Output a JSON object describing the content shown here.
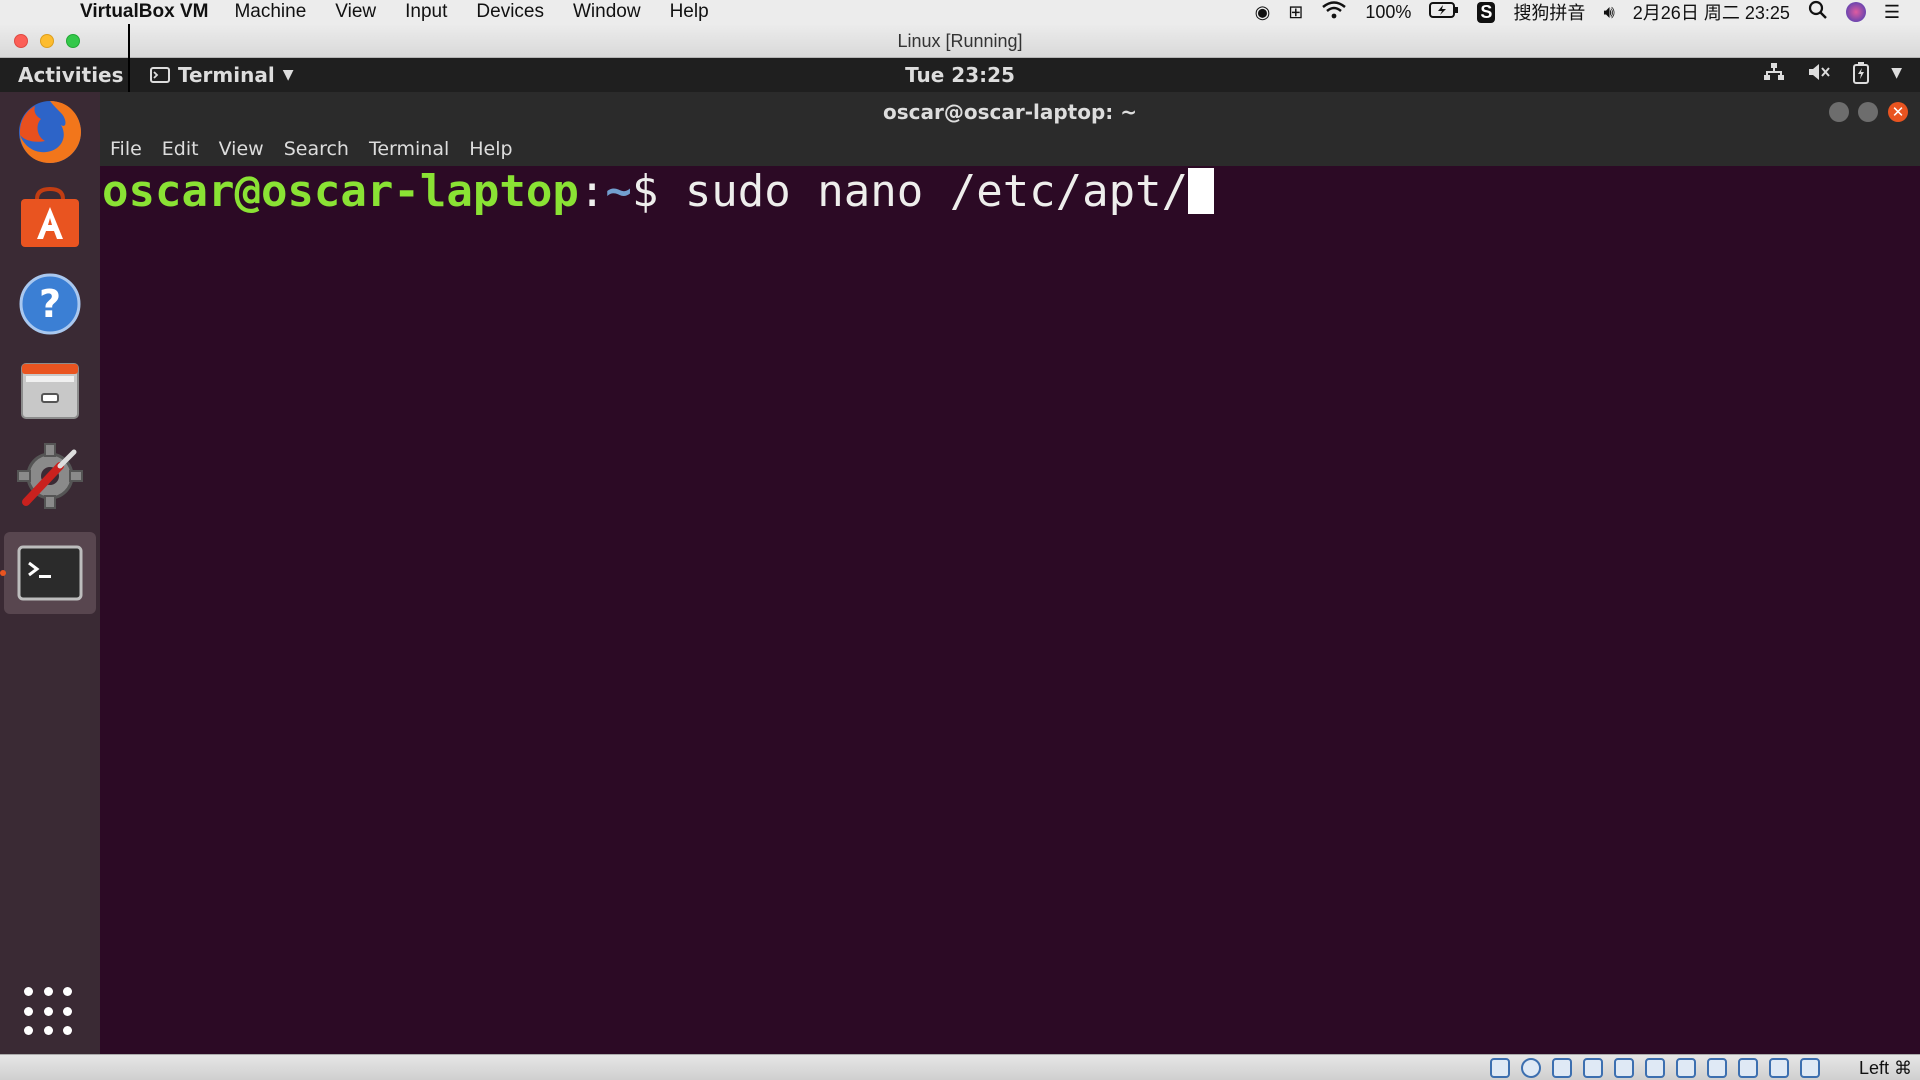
{
  "mac_menubar": {
    "app_name": "VirtualBox VM",
    "menus": [
      "Machine",
      "View",
      "Input",
      "Devices",
      "Window",
      "Help"
    ],
    "battery": "100%",
    "input_method": "搜狗拼音",
    "datetime": "2月26日 周二 23:25"
  },
  "vbox_window": {
    "title": "Linux [Running]",
    "status_host_key": "Left ⌘"
  },
  "ubuntu_panel": {
    "activities": "Activities",
    "app_menu": "Terminal",
    "clock": "Tue 23:25"
  },
  "terminal": {
    "title": "oscar@oscar-laptop: ~",
    "menus": [
      "File",
      "Edit",
      "View",
      "Search",
      "Terminal",
      "Help"
    ],
    "prompt_user": "oscar@oscar-laptop",
    "prompt_sep": ":",
    "prompt_path": "~",
    "prompt_symbol": "$ ",
    "command": "sudo nano /etc/apt/"
  },
  "dock": {
    "items": [
      "firefox-icon",
      "software-center-icon",
      "help-icon",
      "files-icon",
      "settings-tools-icon",
      "terminal-icon"
    ],
    "accent": "#e95420"
  },
  "colors": {
    "terminal_bg": "#2c0a25",
    "prompt_user": "#8ae234",
    "prompt_path": "#729fcf"
  }
}
